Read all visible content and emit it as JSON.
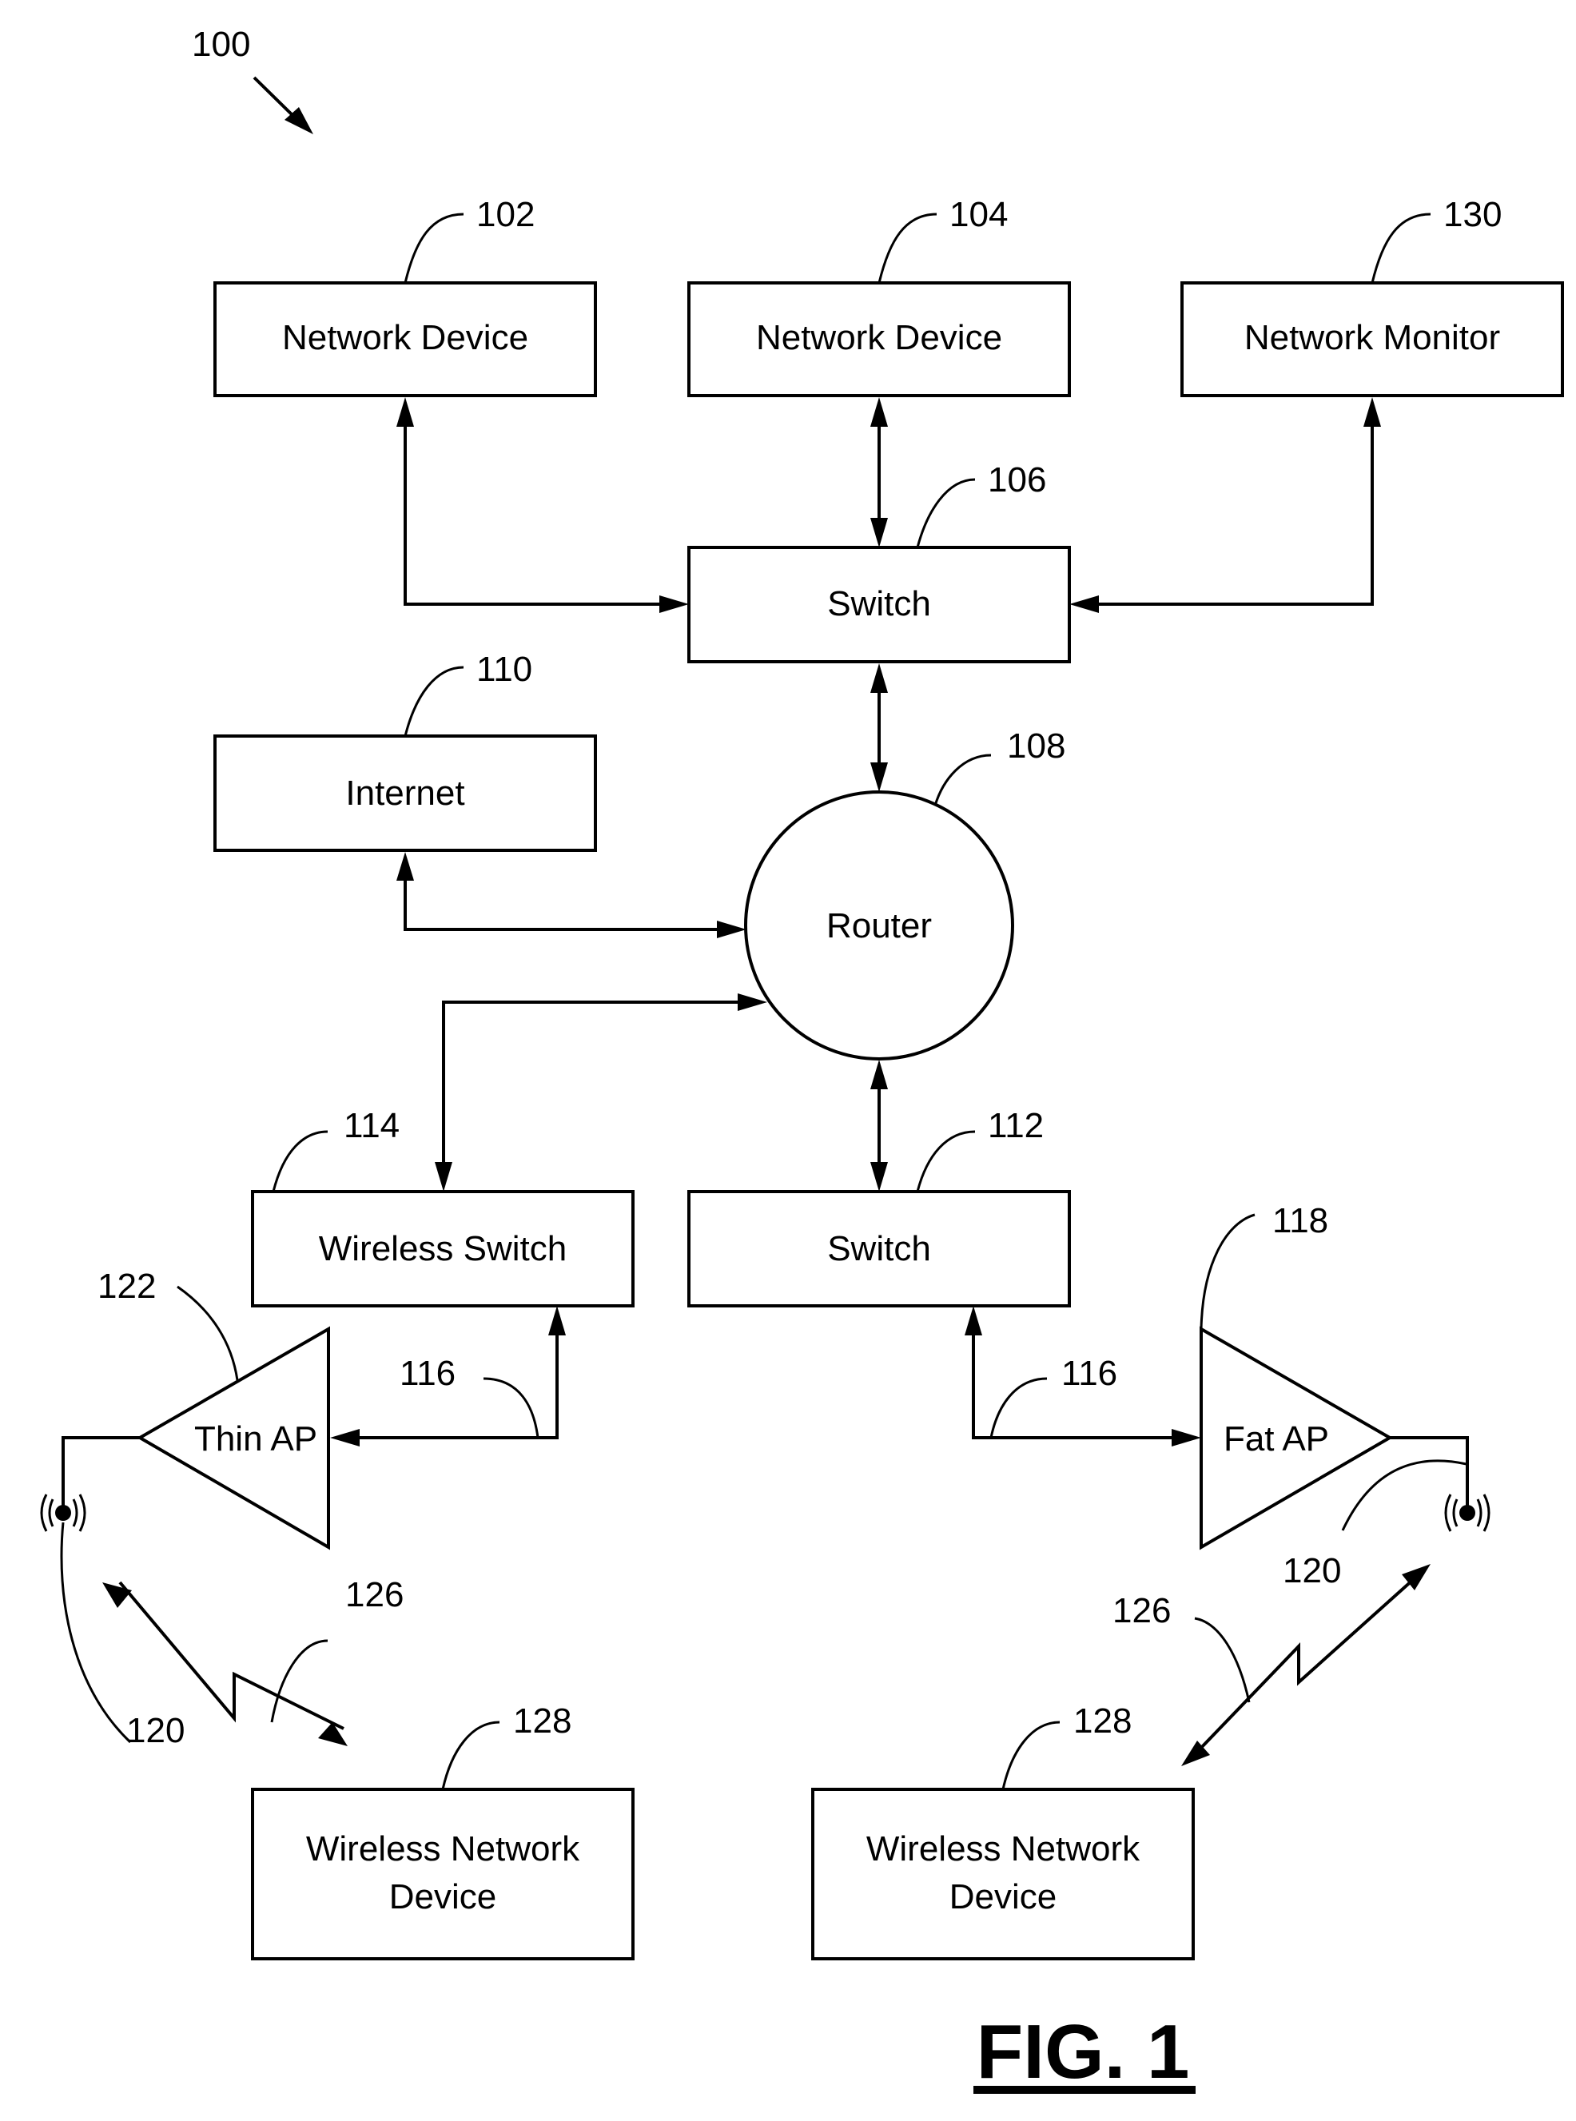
{
  "figure": {
    "ref": "100",
    "caption": "FIG. 1"
  },
  "nodes": {
    "network_device_1": {
      "label": "Network Device",
      "ref": "102"
    },
    "network_device_2": {
      "label": "Network Device",
      "ref": "104"
    },
    "network_monitor": {
      "label": "Network Monitor",
      "ref": "130"
    },
    "switch_top": {
      "label": "Switch",
      "ref": "106"
    },
    "internet": {
      "label": "Internet",
      "ref": "110"
    },
    "router": {
      "label": "Router",
      "ref": "108"
    },
    "wireless_switch": {
      "label": "Wireless Switch",
      "ref": "114"
    },
    "switch_bottom": {
      "label": "Switch",
      "ref": "112"
    },
    "thin_ap": {
      "label": "Thin AP",
      "ref": "122"
    },
    "fat_ap": {
      "label": "Fat AP",
      "ref": "118"
    },
    "wireless_device_left": {
      "label_line1": "Wireless Network",
      "label_line2": "Device",
      "ref": "128"
    },
    "wireless_device_right": {
      "label_line1": "Wireless Network",
      "label_line2": "Device",
      "ref": "128"
    }
  },
  "links": {
    "wired_left_ref": "116",
    "wired_right_ref": "116",
    "antenna_left_ref": "120",
    "antenna_right_ref": "120",
    "wireless_left_ref": "126",
    "wireless_right_ref": "126"
  }
}
